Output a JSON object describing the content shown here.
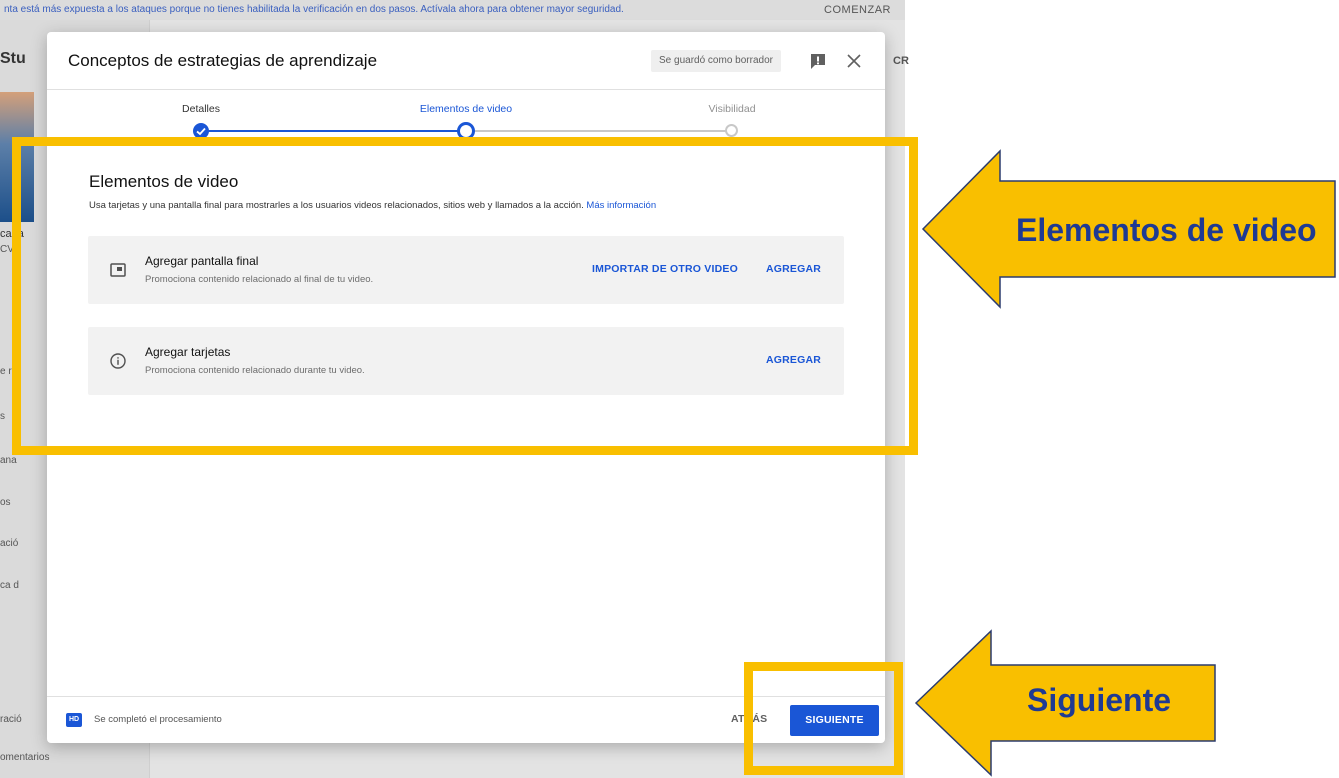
{
  "background": {
    "banner_text": "nta está más expuesta a los ataques porque no tienes habilitada la verificación en dos pasos. Actívala ahora para obtener mayor seguridad.",
    "banner_cta": "COMENZAR",
    "logo_fragment": "Stu",
    "create_fragment": "CR",
    "sidebar_fragments": [
      "cana",
      "CV ε",
      "e re",
      "s",
      "ana",
      "os",
      "ació",
      "ca d",
      "ració",
      "omentarios"
    ]
  },
  "modal": {
    "title": "Conceptos de estrategias de aprendizaje",
    "draft_status": "Se guardó como borrador",
    "feedback_icon": "feedback-icon",
    "close_icon": "close-icon"
  },
  "stepper": {
    "steps": [
      {
        "label": "Detalles",
        "state": "completed"
      },
      {
        "label": "Elementos de video",
        "state": "current"
      },
      {
        "label": "Visibilidad",
        "state": "pending"
      }
    ],
    "accent_color": "#1a56d6"
  },
  "content": {
    "title": "Elementos de video",
    "description": "Usa tarjetas y una pantalla final para mostrarles a los usuarios videos relacionados, sitios web y llamados a la acción.",
    "more_info_link": "Más información",
    "cards": [
      {
        "icon": "end-screen-icon",
        "title": "Agregar pantalla final",
        "subtitle": "Promociona contenido relacionado al final de tu video.",
        "import_label": "IMPORTAR DE OTRO VIDEO",
        "add_label": "AGREGAR"
      },
      {
        "icon": "info-icon",
        "title": "Agregar tarjetas",
        "subtitle": "Promociona contenido relacionado durante tu video.",
        "add_label": "AGREGAR"
      }
    ]
  },
  "footer": {
    "hd_badge": "HD",
    "processing_status": "Se completó el procesamiento",
    "back_label": "ATRÁS",
    "next_label": "SIGUIENTE"
  },
  "annotations": {
    "highlight_color": "#f9bf00",
    "label_color": "#1f3a93",
    "elements_label": "Elementos de video",
    "next_label": "Siguiente"
  }
}
